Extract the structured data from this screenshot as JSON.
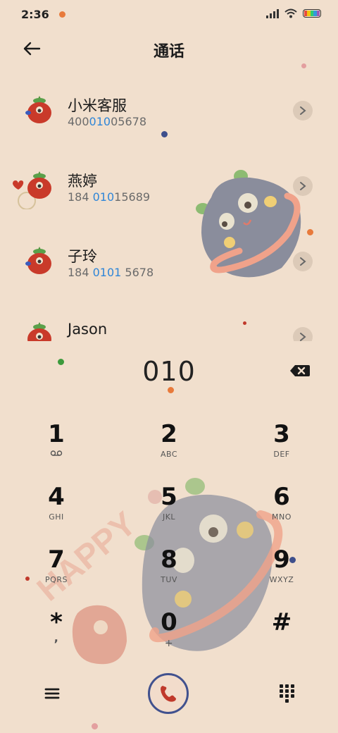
{
  "status_bar": {
    "time": "2:36",
    "icons": [
      "signal-icon",
      "wifi-icon",
      "battery-icon"
    ]
  },
  "header": {
    "title": "通话",
    "back_icon": "arrow-left-icon"
  },
  "contacts": [
    {
      "name": "小米客服",
      "number_parts": [
        "400",
        "010",
        "05678"
      ]
    },
    {
      "name": "燕婷",
      "number_parts": [
        "184 ",
        "010",
        "15689"
      ]
    },
    {
      "name": "子玲",
      "number_parts": [
        "184 ",
        "0101",
        " 5678"
      ]
    },
    {
      "name": "Jason",
      "number_parts": [
        "",
        "",
        ""
      ]
    }
  ],
  "dialer": {
    "dialed": "010",
    "backspace_icon": "backspace-icon"
  },
  "keypad": [
    {
      "digit": "1",
      "letters": ""
    },
    {
      "digit": "2",
      "letters": "ABC"
    },
    {
      "digit": "3",
      "letters": "DEF"
    },
    {
      "digit": "4",
      "letters": "GHI"
    },
    {
      "digit": "5",
      "letters": "JKL"
    },
    {
      "digit": "6",
      "letters": "MNO"
    },
    {
      "digit": "7",
      "letters": "PQRS"
    },
    {
      "digit": "8",
      "letters": "TUV"
    },
    {
      "digit": "9",
      "letters": "WXYZ"
    },
    {
      "digit": "*",
      "letters": ","
    },
    {
      "digit": "0",
      "letters": "+"
    },
    {
      "digit": "#",
      "letters": ""
    }
  ],
  "bottom_bar": {
    "menu_icon": "hamburger-menu-icon",
    "call_icon": "phone-call-icon",
    "dialpad_icon": "dialpad-icon"
  },
  "colors": {
    "background": "#f1dfcd",
    "highlight": "#2f86d8",
    "call_ring": "#41518e",
    "call_phone": "#c0392b"
  }
}
